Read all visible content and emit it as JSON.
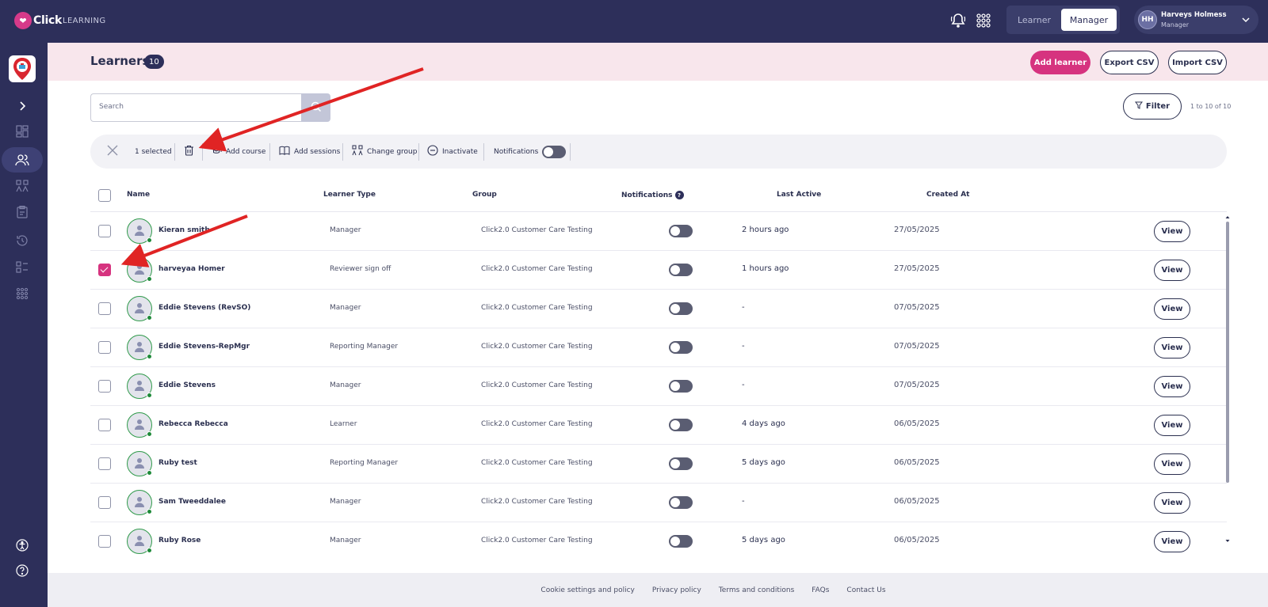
{
  "brand": {
    "name_bold": "Click",
    "name_light": "LEARNING"
  },
  "topbar": {
    "modes": [
      {
        "label": "Learner",
        "active": false
      },
      {
        "label": "Manager",
        "active": true
      }
    ],
    "user": {
      "initials": "HH",
      "name": "Harveys Holmess",
      "role": "Manager"
    }
  },
  "header": {
    "title": "Learners",
    "count": "10",
    "add_label": "Add learner",
    "export_label": "Export CSV",
    "import_label": "Import CSV"
  },
  "search": {
    "placeholder": "Search"
  },
  "filter": {
    "label": "Filter",
    "paging": "1 to 10 of 10"
  },
  "bulk": {
    "selected": "1 selected",
    "add_course": "Add course",
    "add_sessions": "Add sessions",
    "change_group": "Change group",
    "inactivate": "Inactivate",
    "notifications": "Notifications"
  },
  "table": {
    "columns": {
      "name": "Name",
      "type": "Learner Type",
      "group": "Group",
      "notifications": "Notifications",
      "last_active": "Last Active",
      "created": "Created At"
    },
    "view_label": "View",
    "rows": [
      {
        "name": "Kieran smith",
        "type": "Manager",
        "group": "Click2.0 Customer Care Testing",
        "last_active": "2 hours ago",
        "created": "27/05/2025",
        "checked": false
      },
      {
        "name": "harveyaa Homer",
        "type": "Reviewer sign off",
        "group": "Click2.0 Customer Care Testing",
        "last_active": "1 hours ago",
        "created": "27/05/2025",
        "checked": true
      },
      {
        "name": "Eddie Stevens (RevSO)",
        "type": "Manager",
        "group": "Click2.0 Customer Care Testing",
        "last_active": "-",
        "created": "07/05/2025",
        "checked": false
      },
      {
        "name": "Eddie Stevens-RepMgr",
        "type": "Reporting Manager",
        "group": "Click2.0 Customer Care Testing",
        "last_active": "-",
        "created": "07/05/2025",
        "checked": false
      },
      {
        "name": "Eddie Stevens",
        "type": "Manager",
        "group": "Click2.0 Customer Care Testing",
        "last_active": "-",
        "created": "07/05/2025",
        "checked": false
      },
      {
        "name": "Rebecca Rebecca",
        "type": "Learner",
        "group": "Click2.0 Customer Care Testing",
        "last_active": "4 days ago",
        "created": "06/05/2025",
        "checked": false
      },
      {
        "name": "Ruby test",
        "type": "Reporting Manager",
        "group": "Click2.0 Customer Care Testing",
        "last_active": "5 days ago",
        "created": "06/05/2025",
        "checked": false
      },
      {
        "name": "Sam Tweeddalee",
        "type": "Manager",
        "group": "Click2.0 Customer Care Testing",
        "last_active": "-",
        "created": "06/05/2025",
        "checked": false
      },
      {
        "name": "Ruby Rose",
        "type": "Manager",
        "group": "Click2.0 Customer Care Testing",
        "last_active": "5 days ago",
        "created": "06/05/2025",
        "checked": false
      }
    ]
  },
  "footer": {
    "links": [
      "Cookie settings and policy",
      "Privacy policy",
      "Terms and conditions",
      "FAQs",
      "Contact Us"
    ]
  },
  "colors": {
    "navy": "#2d2f5a",
    "accent": "#d6337f",
    "header_band": "#f8e6ec",
    "annotation": "#e02424"
  },
  "icons": [
    "bell-icon",
    "apps-grid-icon",
    "chevron-down-icon",
    "chevron-right-icon",
    "dashboard-icon",
    "users-icon",
    "course-icon",
    "clipboard-icon",
    "history-icon",
    "checklist-icon",
    "grid-dots-icon",
    "accessibility-icon",
    "help-icon",
    "search-icon",
    "filter-icon",
    "close-icon",
    "trash-icon",
    "graduation-cap-icon",
    "book-icon",
    "group-icon",
    "minus-circle-icon",
    "user-icon"
  ]
}
